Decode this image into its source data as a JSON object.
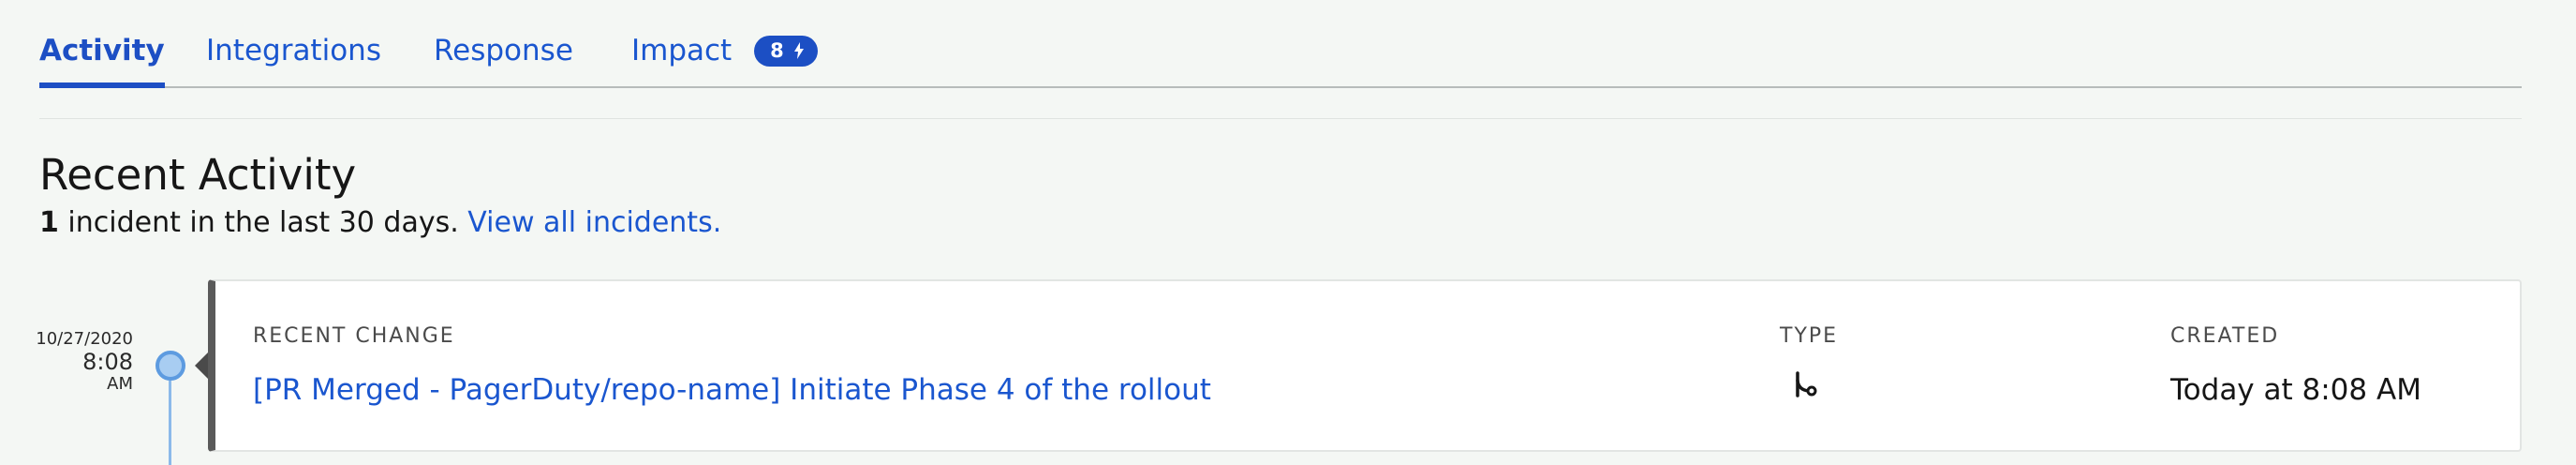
{
  "tabs": [
    {
      "label": "Activity",
      "active": true
    },
    {
      "label": "Integrations",
      "active": false
    },
    {
      "label": "Response",
      "active": false
    },
    {
      "label": "Impact",
      "active": false,
      "badge": "8"
    }
  ],
  "badge_icon": "lightning-icon",
  "section": {
    "title": "Recent Activity",
    "summary_count": "1",
    "summary_text": " incident in the last 30 days. ",
    "summary_link": "View all incidents."
  },
  "timeline": {
    "date": "10/27/2020",
    "time": "8:08",
    "ampm": "AM"
  },
  "card": {
    "change_header": "Recent Change",
    "type_header": "Type",
    "created_header": "Created",
    "change_title": "[PR Merged - PagerDuty/repo-name] Initiate Phase 4 of the rollout",
    "type_icon": "git-merge-icon",
    "created_value": "Today at 8:08 AM"
  },
  "colors": {
    "accent": "#1d4fc4",
    "link": "#1a56cf",
    "background": "#f4f7f4",
    "timeline_dot": "#a8cdf2"
  }
}
